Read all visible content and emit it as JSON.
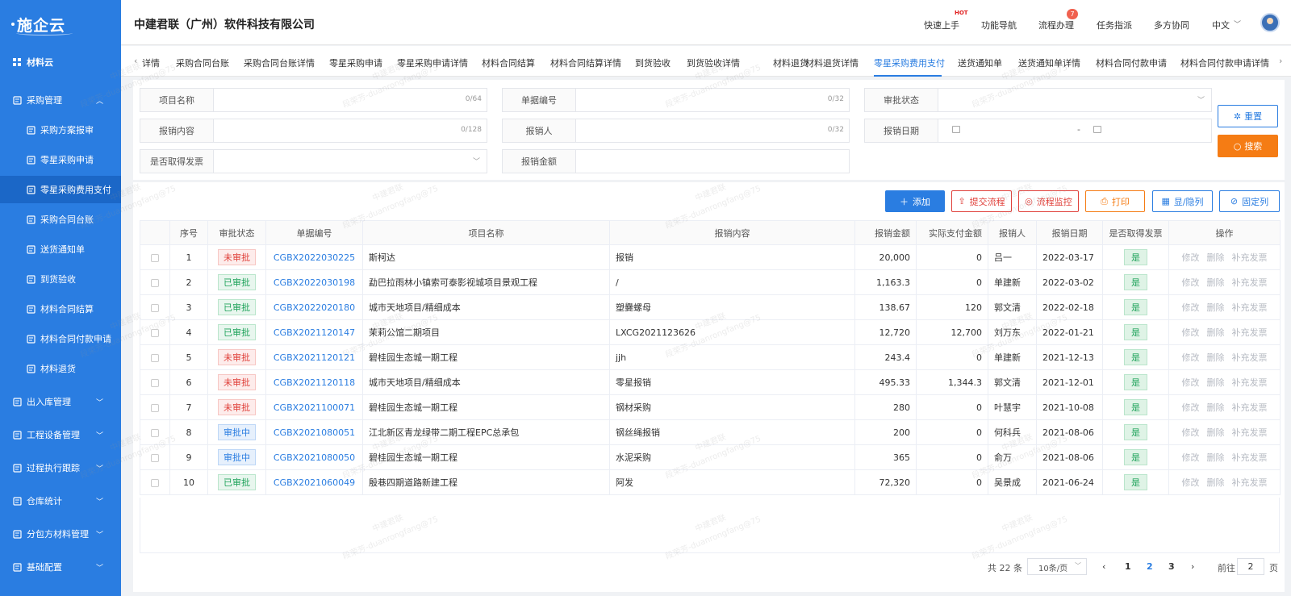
{
  "app": {
    "logo_text": "施企云",
    "company": "中建君联（广州）软件科技有限公司"
  },
  "header": {
    "nav": [
      "快速上手",
      "功能导航",
      "流程办理",
      "任务指派",
      "多方协同",
      "中文"
    ],
    "hot_label": "HOT",
    "badge_count": "7"
  },
  "sidebar": {
    "module": "材料云",
    "items": [
      {
        "label": "采购管理",
        "type": "group",
        "icon": "cart-icon",
        "expanded": true
      },
      {
        "label": "采购方案报审",
        "type": "sub",
        "icon": "file-icon"
      },
      {
        "label": "零星采购申请",
        "type": "sub",
        "icon": "file-edit-icon"
      },
      {
        "label": "零星采购费用支付",
        "type": "sub",
        "icon": "file-pay-icon",
        "active": true
      },
      {
        "label": "采购合同台账",
        "type": "sub",
        "icon": "ledger-icon"
      },
      {
        "label": "送货通知单",
        "type": "sub",
        "icon": "doc-icon"
      },
      {
        "label": "到货验收",
        "type": "sub",
        "icon": "check-doc-icon"
      },
      {
        "label": "材料合同结算",
        "type": "sub",
        "icon": "grid-doc-icon"
      },
      {
        "label": "材料合同付款申请",
        "type": "sub",
        "icon": "pay-doc-icon"
      },
      {
        "label": "材料退货",
        "type": "sub",
        "icon": "return-icon"
      },
      {
        "label": "出入库管理",
        "type": "group",
        "icon": "warehouse-icon"
      },
      {
        "label": "工程设备管理",
        "type": "group",
        "icon": "cube-icon"
      },
      {
        "label": "过程执行跟踪",
        "type": "group",
        "icon": "track-icon"
      },
      {
        "label": "仓库统计",
        "type": "group",
        "icon": "stats-icon"
      },
      {
        "label": "分包方材料管理",
        "type": "group",
        "icon": "package-icon"
      },
      {
        "label": "基础配置",
        "type": "group",
        "icon": "config-icon"
      }
    ]
  },
  "tabs": {
    "items": [
      "详情",
      "采购合同台账",
      "采购合同台账详情",
      "零星采购申请",
      "零星采购申请详情",
      "材料合同结算",
      "材料合同结算详情",
      "到货验收",
      "到货验收详情",
      "材料退货",
      "材料退货详情",
      "零星采购费用支付",
      "送货通知单",
      "送货通知单详情",
      "材料合同付款申请",
      "材料合同付款申请详情"
    ],
    "active_index": 11
  },
  "filters": {
    "project_name": {
      "label": "项目名称",
      "count": "0/64"
    },
    "doc_no": {
      "label": "单据编号",
      "count": "0/32"
    },
    "approval_status": {
      "label": "审批状态"
    },
    "content": {
      "label": "报销内容",
      "count": "0/128"
    },
    "reimburser": {
      "label": "报销人",
      "count": "0/32"
    },
    "date": {
      "label": "报销日期",
      "separator": "-"
    },
    "invoice": {
      "label": "是否取得发票"
    },
    "amount": {
      "label": "报销金额"
    },
    "reset_label": "重置",
    "search_label": "搜索"
  },
  "actions": {
    "add": "添加",
    "submit": "提交流程",
    "monitor": "流程监控",
    "print": "打印",
    "toggle_cols": "显/隐列",
    "fix_cols": "固定列"
  },
  "table": {
    "headers": [
      "序号",
      "审批状态",
      "单据编号",
      "项目名称",
      "报销内容",
      "报销金额",
      "实际支付金额",
      "报销人",
      "报销日期",
      "是否取得发票",
      "操作"
    ],
    "ops": [
      "修改",
      "删除",
      "补充发票"
    ],
    "rows": [
      {
        "no": "1",
        "status": "未审批",
        "tone": "red",
        "code": "CGBX2022030225",
        "project": "斯柯达",
        "content": "报销",
        "amount": "20,000",
        "paid": "0",
        "person": "吕一",
        "date": "2022-03-17",
        "invoice": "是"
      },
      {
        "no": "2",
        "status": "已审批",
        "tone": "green",
        "code": "CGBX2022030198",
        "project": "勐巴拉雨林小镇索可泰影视城项目景观工程",
        "content": "/",
        "amount": "1,163.3",
        "paid": "0",
        "person": "单建新",
        "date": "2022-03-02",
        "invoice": "是"
      },
      {
        "no": "3",
        "status": "已审批",
        "tone": "green",
        "code": "CGBX2022020180",
        "project": "城市天地项目/精细成本",
        "content": "塑爨螺母",
        "amount": "138.67",
        "paid": "120",
        "person": "郭文清",
        "date": "2022-02-18",
        "invoice": "是"
      },
      {
        "no": "4",
        "status": "已审批",
        "tone": "green",
        "code": "CGBX2021120147",
        "project": "茉莉公馆二期项目",
        "content": "LXCG2021123626",
        "amount": "12,720",
        "paid": "12,700",
        "person": "刘万东",
        "date": "2022-01-21",
        "invoice": "是"
      },
      {
        "no": "5",
        "status": "未审批",
        "tone": "red",
        "code": "CGBX2021120121",
        "project": "碧桂园生态城一期工程",
        "content": "jjh",
        "amount": "243.4",
        "paid": "0",
        "person": "单建新",
        "date": "2021-12-13",
        "invoice": "是"
      },
      {
        "no": "6",
        "status": "未审批",
        "tone": "red",
        "code": "CGBX2021120118",
        "project": "城市天地项目/精细成本",
        "content": "零星报销",
        "amount": "495.33",
        "paid": "1,344.3",
        "person": "郭文清",
        "date": "2021-12-01",
        "invoice": "是"
      },
      {
        "no": "7",
        "status": "未审批",
        "tone": "red",
        "code": "CGBX2021100071",
        "project": "碧桂园生态城一期工程",
        "content": "钢材采购",
        "amount": "280",
        "paid": "0",
        "person": "叶慧宇",
        "date": "2021-10-08",
        "invoice": "是"
      },
      {
        "no": "8",
        "status": "审批中",
        "tone": "blue",
        "code": "CGBX2021080051",
        "project": "江北新区青龙绿带二期工程EPC总承包",
        "content": "钢丝绳报销",
        "amount": "200",
        "paid": "0",
        "person": "何科兵",
        "date": "2021-08-06",
        "invoice": "是"
      },
      {
        "no": "9",
        "status": "审批中",
        "tone": "blue",
        "code": "CGBX2021080050",
        "project": "碧桂园生态城一期工程",
        "content": "水泥采购",
        "amount": "365",
        "paid": "0",
        "person": "俞万",
        "date": "2021-08-06",
        "invoice": "是"
      },
      {
        "no": "10",
        "status": "已审批",
        "tone": "green",
        "code": "CGBX2021060049",
        "project": "殷巷四期道路新建工程",
        "content": "阿发",
        "amount": "72,320",
        "paid": "0",
        "person": "吴景成",
        "date": "2021-06-24",
        "invoice": "是"
      }
    ]
  },
  "pagination": {
    "total": "共 22 条",
    "page_size": "10条/页",
    "pages": [
      "1",
      "2",
      "3"
    ],
    "current_page": "2",
    "goto_prefix": "前往",
    "goto_value": "2",
    "goto_suffix": "页"
  },
  "watermark": [
    "中建君联",
    "段荣芳-duanrongfang@75"
  ],
  "colors": {
    "primary": "#2a7de1",
    "search": "#f57c14",
    "danger": "#e0403a",
    "success": "#1fa35a"
  }
}
